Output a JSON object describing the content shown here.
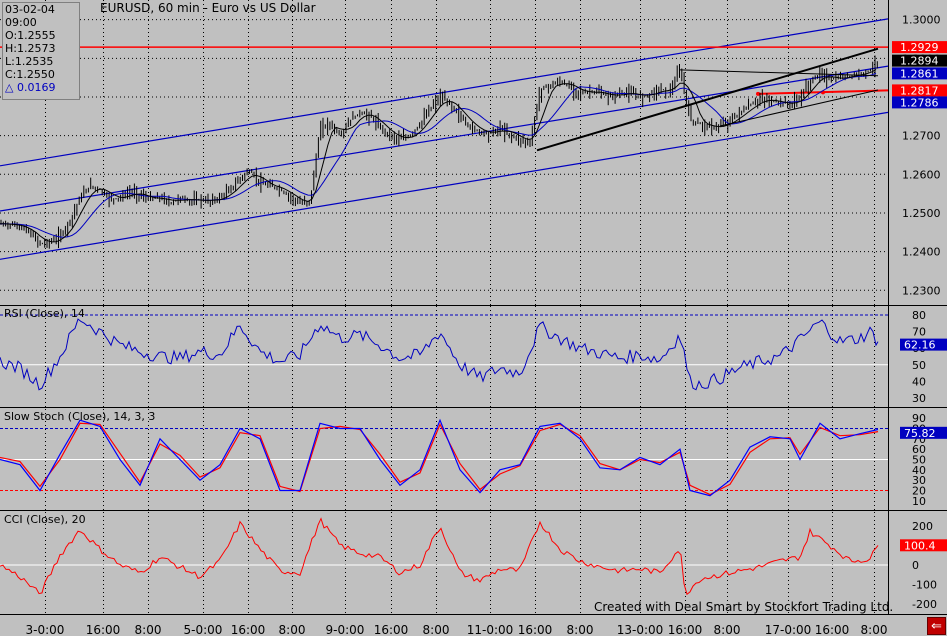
{
  "header": {
    "date": "03-02-04",
    "time": "09:00",
    "open": "O:1.2555",
    "high": "H:1.2573",
    "low": "L:1.2535",
    "close": "C:1.2550",
    "delta": "△ 0.0169",
    "title": "EURUSD, 60 min - Euro vs US Dollar"
  },
  "footer": {
    "credit": "Created with Deal Smart by Stockfort Trading Ltd.",
    "back_icon": "arrow-left-icon"
  },
  "colors": {
    "background": "#c0c0c0",
    "bars": "#000000",
    "trend": "#0000c0",
    "resistance": "#ff0000",
    "rsi": "#0000c0",
    "stoch_k": "#0000ff",
    "stoch_d": "#ff0000",
    "cci": "#ff0000"
  },
  "chart_data": [
    {
      "type": "ohlc",
      "title": "EURUSD, 60 min - Euro vs US Dollar",
      "x_ticks": [
        "3-0:00",
        "16:00",
        "8:00",
        "5-0:00",
        "16:00",
        "8:00",
        "9-0:00",
        "16:00",
        "8:00",
        "11-0:00",
        "16:00",
        "8:00",
        "13-0:00",
        "16:00",
        "8:00",
        "17-0:00",
        "16:00",
        "8:00"
      ],
      "y_ticks": [
        "1.3000",
        "1.2900",
        "1.2800",
        "1.2700",
        "1.2600",
        "1.2500",
        "1.2400",
        "1.2300"
      ],
      "ylim": [
        1.228,
        1.3025
      ],
      "price_tags": [
        {
          "label": "1.2929",
          "color": "#ff0000"
        },
        {
          "label": "1.2894",
          "color": "#000000"
        },
        {
          "label": "1.2861",
          "color": "#0000c0"
        },
        {
          "label": "1.2817",
          "color": "#ff0000"
        },
        {
          "label": "1.2786",
          "color": "#0000c0"
        }
      ],
      "close_path": [
        [
          0,
          1.2472
        ],
        [
          10,
          1.247
        ],
        [
          20,
          1.2465
        ],
        [
          30,
          1.2448
        ],
        [
          40,
          1.242
        ],
        [
          50,
          1.2425
        ],
        [
          60,
          1.244
        ],
        [
          70,
          1.248
        ],
        [
          80,
          1.254
        ],
        [
          90,
          1.257
        ],
        [
          100,
          1.256
        ],
        [
          110,
          1.2535
        ],
        [
          120,
          1.254
        ],
        [
          130,
          1.2555
        ],
        [
          140,
          1.2545
        ],
        [
          150,
          1.2535
        ],
        [
          160,
          1.254
        ],
        [
          170,
          1.2525
        ],
        [
          180,
          1.254
        ],
        [
          190,
          1.253
        ],
        [
          200,
          1.2535
        ],
        [
          210,
          1.253
        ],
        [
          220,
          1.254
        ],
        [
          230,
          1.256
        ],
        [
          240,
          1.259
        ],
        [
          250,
          1.261
        ],
        [
          260,
          1.2575
        ],
        [
          270,
          1.257
        ],
        [
          280,
          1.256
        ],
        [
          290,
          1.254
        ],
        [
          300,
          1.2525
        ],
        [
          310,
          1.253
        ],
        [
          320,
          1.272
        ],
        [
          330,
          1.273
        ],
        [
          340,
          1.27
        ],
        [
          350,
          1.274
        ],
        [
          360,
          1.276
        ],
        [
          370,
          1.275
        ],
        [
          380,
          1.272
        ],
        [
          390,
          1.27
        ],
        [
          400,
          1.269
        ],
        [
          410,
          1.27
        ],
        [
          420,
          1.273
        ],
        [
          430,
          1.277
        ],
        [
          440,
          1.28
        ],
        [
          450,
          1.278
        ],
        [
          460,
          1.275
        ],
        [
          470,
          1.272
        ],
        [
          480,
          1.271
        ],
        [
          490,
          1.2705
        ],
        [
          500,
          1.272
        ],
        [
          510,
          1.27
        ],
        [
          520,
          1.269
        ],
        [
          530,
          1.268
        ],
        [
          540,
          1.282
        ],
        [
          550,
          1.283
        ],
        [
          560,
          1.284
        ],
        [
          570,
          1.2825
        ],
        [
          580,
          1.281
        ],
        [
          590,
          1.2815
        ],
        [
          600,
          1.281
        ],
        [
          610,
          1.28
        ],
        [
          620,
          1.281
        ],
        [
          630,
          1.281
        ],
        [
          640,
          1.28
        ],
        [
          650,
          1.281
        ],
        [
          660,
          1.282
        ],
        [
          670,
          1.2815
        ],
        [
          680,
          1.287
        ],
        [
          690,
          1.274
        ],
        [
          700,
          1.273
        ],
        [
          710,
          1.272
        ],
        [
          720,
          1.2725
        ],
        [
          730,
          1.274
        ],
        [
          740,
          1.276
        ],
        [
          750,
          1.278
        ],
        [
          760,
          1.2795
        ],
        [
          770,
          1.279
        ],
        [
          780,
          1.2785
        ],
        [
          790,
          1.278
        ],
        [
          800,
          1.28
        ],
        [
          810,
          1.284
        ],
        [
          820,
          1.286
        ],
        [
          830,
          1.2845
        ],
        [
          840,
          1.285
        ],
        [
          850,
          1.2855
        ],
        [
          860,
          1.286
        ],
        [
          870,
          1.287
        ],
        [
          878,
          1.2894
        ]
      ],
      "trend_channel": {
        "lines": [
          [
            [
              0,
              1.2622
            ],
            [
              888,
              1.3002
            ]
          ],
          [
            [
              0,
              1.2505
            ],
            [
              888,
              1.288
            ]
          ],
          [
            [
              0,
              1.238
            ],
            [
              888,
              1.276
            ]
          ]
        ]
      },
      "resistance": [
        [
          [
            0,
            1.2929
          ],
          [
            888,
            1.2929
          ]
        ],
        [
          [
            758,
            1.2808
          ],
          [
            888,
            1.2817
          ]
        ]
      ],
      "wedge": [
        [
          [
            537,
            1.2662
          ],
          [
            878,
            1.2925
          ]
        ],
        [
          [
            680,
            1.287
          ],
          [
            878,
            1.2855
          ]
        ],
        [
          [
            720,
            1.2725
          ],
          [
            878,
            1.2818
          ]
        ]
      ]
    },
    {
      "type": "line",
      "title": "RSI (Close), 14",
      "y_ticks": [
        "80",
        "70",
        "60",
        "50",
        "40",
        "30"
      ],
      "ylim": [
        27,
        83
      ],
      "last_value": "62.16",
      "values": [
        [
          0,
          52
        ],
        [
          20,
          48
        ],
        [
          40,
          38
        ],
        [
          60,
          55
        ],
        [
          80,
          78
        ],
        [
          100,
          70
        ],
        [
          120,
          62
        ],
        [
          140,
          58
        ],
        [
          160,
          55
        ],
        [
          180,
          54
        ],
        [
          200,
          58
        ],
        [
          220,
          56
        ],
        [
          240,
          74
        ],
        [
          260,
          58
        ],
        [
          280,
          52
        ],
        [
          300,
          56
        ],
        [
          320,
          75
        ],
        [
          340,
          66
        ],
        [
          360,
          68
        ],
        [
          380,
          62
        ],
        [
          400,
          54
        ],
        [
          420,
          56
        ],
        [
          440,
          70
        ],
        [
          460,
          50
        ],
        [
          480,
          42
        ],
        [
          500,
          48
        ],
        [
          520,
          45
        ],
        [
          540,
          73
        ],
        [
          560,
          66
        ],
        [
          580,
          60
        ],
        [
          600,
          57
        ],
        [
          620,
          54
        ],
        [
          640,
          56
        ],
        [
          660,
          53
        ],
        [
          680,
          68
        ],
        [
          690,
          40
        ],
        [
          700,
          38
        ],
        [
          720,
          42
        ],
        [
          740,
          48
        ],
        [
          760,
          52
        ],
        [
          780,
          55
        ],
        [
          800,
          65
        ],
        [
          820,
          76
        ],
        [
          840,
          64
        ],
        [
          860,
          66
        ],
        [
          870,
          70
        ],
        [
          878,
          64
        ]
      ]
    },
    {
      "type": "line",
      "title": "Slow Stoch (Close), 14, 3, 3",
      "y_ticks": [
        "90",
        "80",
        "70",
        "60",
        "50",
        "40",
        "30",
        "20",
        "10"
      ],
      "ylim": [
        5,
        95
      ],
      "last_value": "75.82",
      "series": [
        {
          "name": "%K",
          "values": [
            [
              0,
              50
            ],
            [
              20,
              45
            ],
            [
              40,
              20
            ],
            [
              60,
              55
            ],
            [
              80,
              88
            ],
            [
              100,
              82
            ],
            [
              120,
              50
            ],
            [
              140,
              25
            ],
            [
              160,
              70
            ],
            [
              180,
              50
            ],
            [
              200,
              30
            ],
            [
              220,
              45
            ],
            [
              240,
              80
            ],
            [
              260,
              70
            ],
            [
              280,
              20
            ],
            [
              300,
              20
            ],
            [
              320,
              85
            ],
            [
              340,
              80
            ],
            [
              360,
              80
            ],
            [
              380,
              50
            ],
            [
              400,
              25
            ],
            [
              420,
              40
            ],
            [
              440,
              88
            ],
            [
              460,
              40
            ],
            [
              480,
              18
            ],
            [
              500,
              40
            ],
            [
              520,
              45
            ],
            [
              540,
              82
            ],
            [
              560,
              85
            ],
            [
              580,
              70
            ],
            [
              600,
              42
            ],
            [
              620,
              40
            ],
            [
              640,
              52
            ],
            [
              660,
              45
            ],
            [
              680,
              60
            ],
            [
              690,
              20
            ],
            [
              710,
              15
            ],
            [
              730,
              30
            ],
            [
              750,
              62
            ],
            [
              770,
              72
            ],
            [
              790,
              70
            ],
            [
              800,
              50
            ],
            [
              820,
              85
            ],
            [
              840,
              70
            ],
            [
              860,
              75
            ],
            [
              878,
              79
            ]
          ]
        },
        {
          "name": "%D",
          "values": [
            [
              0,
              52
            ],
            [
              20,
              48
            ],
            [
              40,
              24
            ],
            [
              60,
              50
            ],
            [
              80,
              85
            ],
            [
              100,
              84
            ],
            [
              120,
              56
            ],
            [
              140,
              28
            ],
            [
              160,
              65
            ],
            [
              180,
              54
            ],
            [
              200,
              33
            ],
            [
              220,
              42
            ],
            [
              240,
              76
            ],
            [
              260,
              73
            ],
            [
              280,
              24
            ],
            [
              300,
              19
            ],
            [
              320,
              80
            ],
            [
              340,
              82
            ],
            [
              360,
              79
            ],
            [
              380,
              55
            ],
            [
              400,
              28
            ],
            [
              420,
              37
            ],
            [
              440,
              84
            ],
            [
              460,
              46
            ],
            [
              480,
              21
            ],
            [
              500,
              36
            ],
            [
              520,
              44
            ],
            [
              540,
              78
            ],
            [
              560,
              84
            ],
            [
              580,
              73
            ],
            [
              600,
              46
            ],
            [
              620,
              40
            ],
            [
              640,
              50
            ],
            [
              660,
              47
            ],
            [
              680,
              57
            ],
            [
              690,
              25
            ],
            [
              710,
              16
            ],
            [
              730,
              26
            ],
            [
              750,
              57
            ],
            [
              770,
              70
            ],
            [
              790,
              71
            ],
            [
              800,
              55
            ],
            [
              820,
              81
            ],
            [
              840,
              73
            ],
            [
              860,
              74
            ],
            [
              878,
              77
            ]
          ]
        }
      ]
    },
    {
      "type": "line",
      "title": "CCI (Close), 20",
      "y_ticks": [
        "200",
        "100",
        "0",
        "-100",
        "-200"
      ],
      "ylim": [
        -230,
        250
      ],
      "last_value": "100.4",
      "values": [
        [
          0,
          0
        ],
        [
          20,
          -60
        ],
        [
          40,
          -150
        ],
        [
          60,
          50
        ],
        [
          80,
          180
        ],
        [
          100,
          80
        ],
        [
          120,
          0
        ],
        [
          140,
          -40
        ],
        [
          160,
          40
        ],
        [
          180,
          -10
        ],
        [
          200,
          -60
        ],
        [
          220,
          20
        ],
        [
          240,
          210
        ],
        [
          260,
          80
        ],
        [
          280,
          -30
        ],
        [
          300,
          -40
        ],
        [
          320,
          230
        ],
        [
          340,
          100
        ],
        [
          360,
          60
        ],
        [
          380,
          40
        ],
        [
          400,
          -40
        ],
        [
          420,
          0
        ],
        [
          440,
          200
        ],
        [
          460,
          -40
        ],
        [
          480,
          -80
        ],
        [
          500,
          -20
        ],
        [
          520,
          -30
        ],
        [
          540,
          220
        ],
        [
          560,
          80
        ],
        [
          580,
          20
        ],
        [
          600,
          -10
        ],
        [
          620,
          -30
        ],
        [
          640,
          -20
        ],
        [
          660,
          -40
        ],
        [
          680,
          90
        ],
        [
          685,
          -150
        ],
        [
          700,
          -70
        ],
        [
          720,
          -50
        ],
        [
          740,
          -30
        ],
        [
          760,
          -10
        ],
        [
          780,
          20
        ],
        [
          800,
          40
        ],
        [
          810,
          170
        ],
        [
          830,
          100
        ],
        [
          850,
          20
        ],
        [
          870,
          30
        ],
        [
          878,
          100
        ]
      ]
    }
  ]
}
